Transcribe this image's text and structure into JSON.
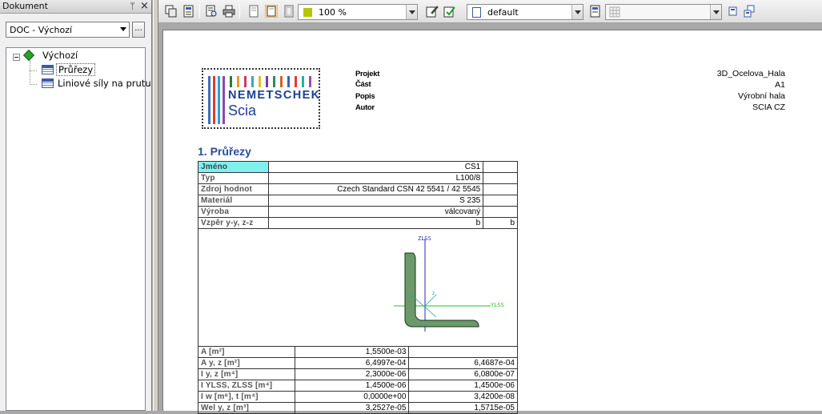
{
  "panel": {
    "title": "Dokument",
    "pin_glyph": "ᛘ",
    "close_glyph": "×",
    "document_select": "DOC - Výchozí",
    "more_label": "...",
    "tree": {
      "root": "Výchozí",
      "items": [
        "Průřezy",
        "Liniové síly na prutu"
      ]
    }
  },
  "toolbar": {
    "zoom": "100 %",
    "style": "default",
    "zoom_color": "#b8c400"
  },
  "document": {
    "logo": {
      "word": "NEMETSCHEK",
      "sub": "Scia"
    },
    "header": {
      "keys": [
        "Projekt",
        "Část",
        "Popis",
        "Autor"
      ],
      "values": [
        "3D_Ocelova_Hala",
        "A1",
        "Výrobní hala",
        "SCIA CZ"
      ]
    },
    "section_title": "1. Průřezy",
    "properties": [
      {
        "key": "Jméno",
        "value": "CS1",
        "extra": ""
      },
      {
        "key": "Typ",
        "value": "L100/8",
        "extra": ""
      },
      {
        "key": "Zdroj  hodnot",
        "value": "Czech  Standard  CSN  42  5541  /  42  5545",
        "extra": ""
      },
      {
        "key": "Materiál",
        "value": "S  235",
        "extra": ""
      },
      {
        "key": "Výroba",
        "value": "válcovaný",
        "extra": ""
      },
      {
        "key": "Vzpěr  y-y,  z-z",
        "value": "b",
        "extra": "b"
      }
    ],
    "drawing": {
      "z_axis": "ZLSS",
      "y_axis": "YLSS"
    },
    "values": [
      {
        "key": "A  [m²]",
        "v1": "1,5500e-03",
        "v2": ""
      },
      {
        "key": "A  y,  z  [m²]",
        "v1": "6,4997e-04",
        "v2": "6,4687e-04"
      },
      {
        "key": "I  y,  z  [m⁴]",
        "v1": "2,3000e-06",
        "v2": "6,0800e-07"
      },
      {
        "key": "I  YLSS,  ZLSS  [m⁴]",
        "v1": "1,4500e-06",
        "v2": "1,4500e-06"
      },
      {
        "key": "I  w  [m⁶],  t  [m⁴]",
        "v1": "0,0000e+00",
        "v2": "3,4200e-08"
      },
      {
        "key": "Wel  y,  z  [m³]",
        "v1": "3,2527e-05",
        "v2": "1,5715e-05"
      }
    ]
  }
}
